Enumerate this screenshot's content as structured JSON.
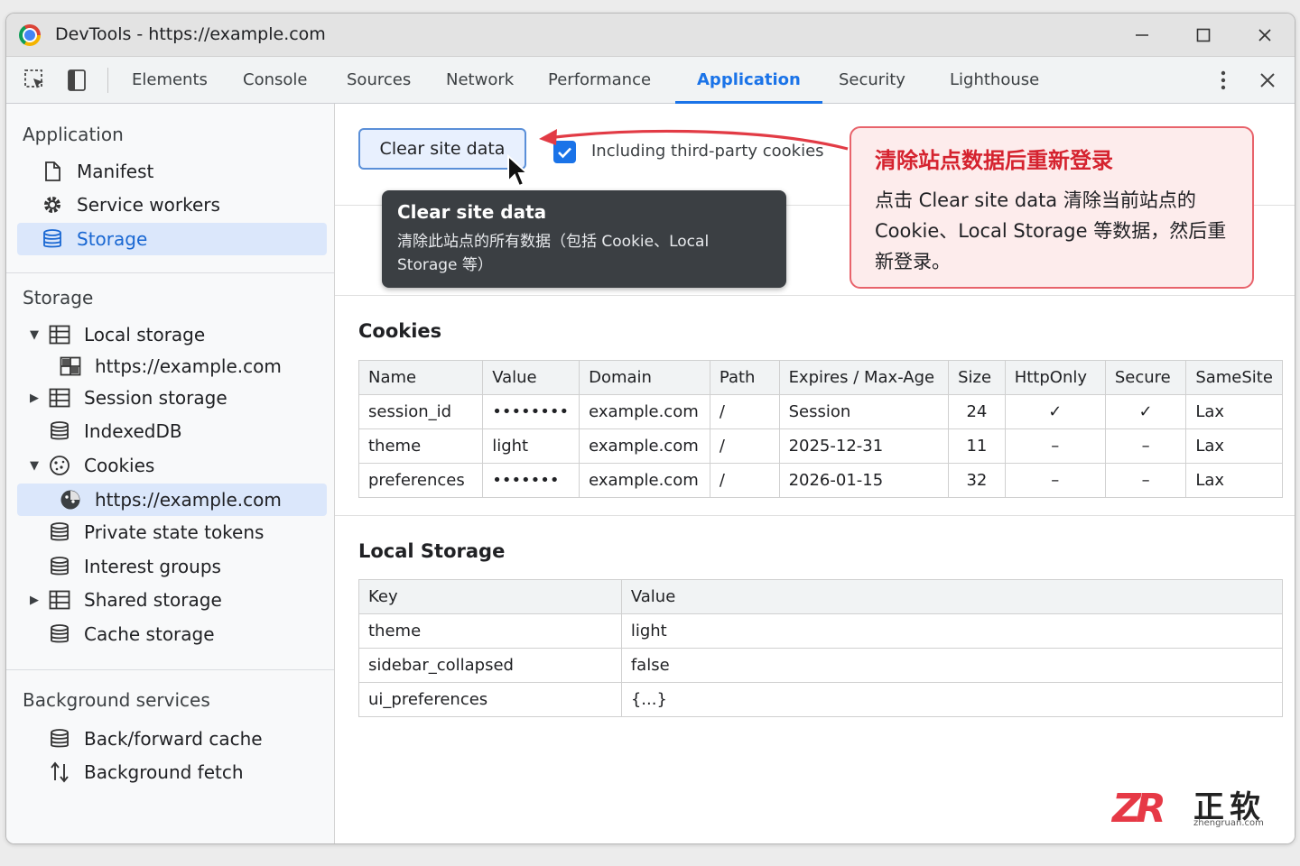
{
  "window": {
    "title": "DevTools - https://example.com"
  },
  "toolbar": {
    "tabs": [
      "Elements",
      "Console",
      "Sources",
      "Network",
      "Performance",
      "Application",
      "Security",
      "Lighthouse"
    ],
    "active_tab": "Application"
  },
  "sidebar": {
    "application_header": "Application",
    "application_items": [
      {
        "label": "Manifest",
        "icon": "document-icon"
      },
      {
        "label": "Service workers",
        "icon": "gear-icon"
      },
      {
        "label": "Storage",
        "icon": "database-icon",
        "selected": true
      }
    ],
    "storage_header": "Storage",
    "storage_items": [
      {
        "label": "Local storage",
        "icon": "table-icon",
        "expanded": true
      },
      {
        "label": "https://example.com",
        "icon": "table-icon"
      },
      {
        "label": "Session storage",
        "icon": "table-icon",
        "expanded": false
      },
      {
        "label": "IndexedDB",
        "icon": "database-icon"
      },
      {
        "label": "Cookies",
        "icon": "cookie-icon",
        "expanded": true
      },
      {
        "label": "https://example.com",
        "icon": "cookie-icon",
        "selected": true
      },
      {
        "label": "Private state tokens",
        "icon": "database-icon"
      },
      {
        "label": "Interest groups",
        "icon": "database-icon"
      },
      {
        "label": "Shared storage",
        "icon": "table-icon",
        "expanded": false
      },
      {
        "label": "Cache storage",
        "icon": "database-icon"
      }
    ],
    "background_header": "Background services",
    "background_items": [
      {
        "label": "Back/forward cache",
        "icon": "database-icon"
      },
      {
        "label": "Background fetch",
        "icon": "up-down-arrows-icon"
      }
    ]
  },
  "main": {
    "clear_button": "Clear site data",
    "third_party_checkbox": {
      "label": "Including third-party cookies",
      "checked": true
    },
    "tooltip": {
      "title": "Clear site data",
      "body": "清除此站点的所有数据（包括 Cookie、Local Storage 等）"
    },
    "annotation": {
      "title": "清除站点数据后重新登录",
      "body": "点击 Clear site data 清除当前站点的 Cookie、Local Storage 等数据，然后重新登录。"
    },
    "cookies": {
      "title": "Cookies",
      "columns": [
        "Name",
        "Value",
        "Domain",
        "Path",
        "Expires / Max-Age",
        "Size",
        "HttpOnly",
        "Secure",
        "SameSite"
      ],
      "rows": [
        [
          "session_id",
          "••••••••",
          "example.com",
          "/",
          "Session",
          "24",
          "✓",
          "✓",
          "Lax"
        ],
        [
          "theme",
          "light",
          "example.com",
          "/",
          "2025-12-31",
          "11",
          "–",
          "–",
          "Lax"
        ],
        [
          "preferences",
          "•••••••",
          "example.com",
          "/",
          "2026-01-15",
          "32",
          "–",
          "–",
          "Lax"
        ]
      ]
    },
    "local_storage": {
      "title": "Local Storage",
      "columns": [
        "Key",
        "Value"
      ],
      "rows": [
        [
          "theme",
          "light"
        ],
        [
          "sidebar_collapsed",
          "false"
        ],
        [
          "ui_preferences",
          "{...}"
        ]
      ]
    }
  },
  "watermark": {
    "mark": "ZR",
    "name": "正软",
    "url": "zhengruan.com"
  },
  "colors": {
    "accent": "#1a73e8",
    "annotation_red": "#d5232f",
    "annotation_bg": "#fdecec"
  }
}
